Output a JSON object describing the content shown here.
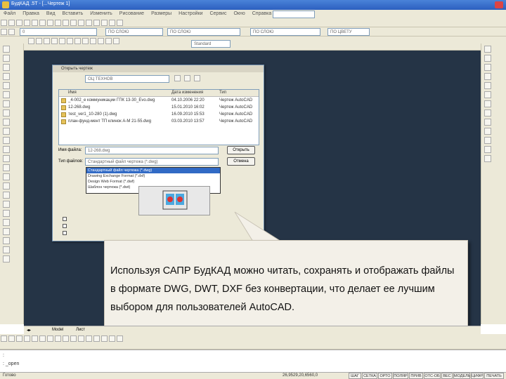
{
  "window": {
    "title": "БудКАД .5Т - [...Чертеж 1]"
  },
  "menu": [
    "Файл",
    "Правка",
    "Вид",
    "Вставить",
    "Изменить",
    "Рисование",
    "Размеры",
    "Настройки",
    "Сервис",
    "Окно",
    "Справка"
  ],
  "toolbar": {
    "combo1": "",
    "combo_layer": "0",
    "combo_color": "ПО СЛОЮ",
    "combo_linetype": "ПО СЛОЮ",
    "combo_lineweight": "ПО СЛОЮ",
    "combo_plot": "ПО ЦВЕТУ",
    "combo_style": "Standard"
  },
  "dialog": {
    "title": "Открыть чертеж",
    "folder": "ОЦ ТЕХНОВ",
    "columns": [
      "Имя",
      "Дата изменения",
      "Тип"
    ],
    "files": [
      {
        "name": "_4-002_е коммуникации ГПК 13-30_Evo.dwg",
        "date": "04.10.2006 22:20",
        "type": "Чертеж AutoCAD"
      },
      {
        "name": "12-268.dwg",
        "date": "15.01.2010 16:02",
        "type": "Чертеж AutoCAD"
      },
      {
        "name": "тest_ver1_10-280 (1).dwg",
        "date": "16.09.2010 15:53",
        "type": "Чертеж AutoCAD"
      },
      {
        "name": "план-фунд-мент ТП клинок А-М 21-55.dwg",
        "date": "03.03.2010 13:57",
        "type": "Чертеж AutoCAD"
      }
    ],
    "filename_label": "Имя файла:",
    "filename_value": "12-268.dwg",
    "filetype_label": "Тип файлов:",
    "filetype_value": "Стандартный файл чертежа (*.dwg)",
    "filetype_options": [
      "Стандартный файл чертежа (*.dwg)",
      "Drawing Exchange Format (*.dxf)",
      "Design Web Format (*.dwf)",
      "Шаблон чертежа (*.dwt)"
    ],
    "open_label": "Открыть",
    "cancel_label": "Отмена"
  },
  "callout": {
    "text": "Используя САПР БудКАД можно читать, сохранять и отображать файлы в формате DWG, DWT, DXF без конвертации,  что делает ее лучшим выбором для пользователей AutoCAD."
  },
  "tabs": [
    "Model",
    "Лист"
  ],
  "command": {
    "line1": ":",
    "line2": ": _open"
  },
  "status": {
    "left": "Готово",
    "coords": "26,9529,20,6560,0",
    "buttons": [
      "ШАГ",
      "СЕТКА",
      "ОРТО",
      "ПОЛЯР",
      "ПРИВ",
      "ОТС-ОБ",
      "ВЕС",
      "МОДЕЛЬ",
      "ЦИФР",
      "ПЕЧАТЬ"
    ]
  }
}
